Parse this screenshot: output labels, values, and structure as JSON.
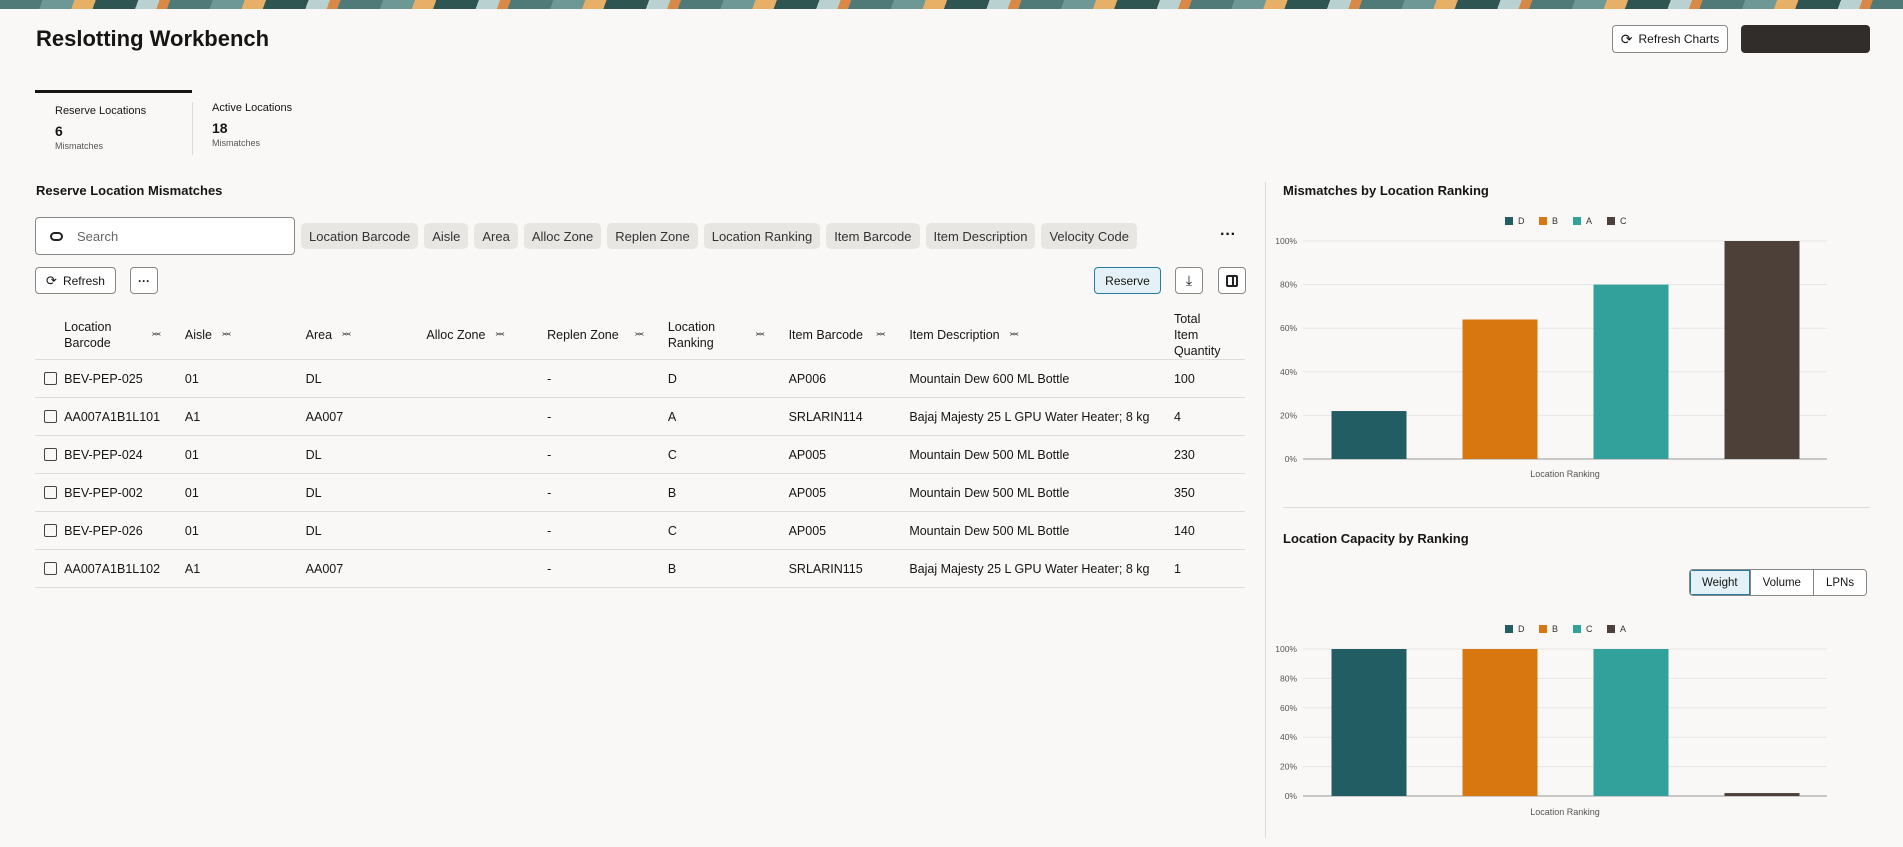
{
  "header": {
    "title": "Reslotting Workbench",
    "refresh_charts": "Refresh Charts"
  },
  "tabs": [
    {
      "label": "Reserve Locations",
      "count": "6",
      "sub": "Mismatches"
    },
    {
      "label": "Active Locations",
      "count": "18",
      "sub": "Mismatches"
    }
  ],
  "section_title": "Reserve Location Mismatches",
  "search": {
    "placeholder": "Search"
  },
  "filter_chips": [
    "Location Barcode",
    "Aisle",
    "Area",
    "Alloc Zone",
    "Replen Zone",
    "Location Ranking",
    "Item Barcode",
    "Item Description",
    "Velocity Code"
  ],
  "toolbar": {
    "refresh": "Refresh",
    "reserve": "Reserve"
  },
  "table": {
    "columns": [
      "Location Barcode",
      "Aisle",
      "Area",
      "Alloc Zone",
      "Replen Zone",
      "Location Ranking",
      "Item Barcode",
      "Item Description",
      "Total Item Quantity"
    ],
    "rows": [
      [
        "BEV-PEP-025",
        "01",
        "DL",
        "",
        "-",
        "D",
        "AP006",
        "Mountain Dew 600 ML Bottle",
        "100"
      ],
      [
        "AA007A1B1L101",
        "A1",
        "AA007",
        "",
        "-",
        "A",
        "SRLARIN114",
        "Bajaj Majesty 25 L GPU Water Heater; 8 kg",
        "4"
      ],
      [
        "BEV-PEP-024",
        "01",
        "DL",
        "",
        "-",
        "C",
        "AP005",
        "Mountain Dew 500 ML Bottle",
        "230"
      ],
      [
        "BEV-PEP-002",
        "01",
        "DL",
        "",
        "-",
        "B",
        "AP005",
        "Mountain Dew 500 ML Bottle",
        "350"
      ],
      [
        "BEV-PEP-026",
        "01",
        "DL",
        "",
        "-",
        "C",
        "AP005",
        "Mountain Dew 500 ML Bottle",
        "140"
      ],
      [
        "AA007A1B1L102",
        "A1",
        "AA007",
        "",
        "-",
        "B",
        "SRLARIN115",
        "Bajaj Majesty 25 L GPU Water Heater; 8 kg",
        "1"
      ]
    ]
  },
  "capacity_toggle": [
    "Weight",
    "Volume",
    "LPNs"
  ],
  "chart_data": [
    {
      "type": "bar",
      "title": "Mismatches by Location Ranking",
      "xlabel": "Location Ranking",
      "ylabel": "",
      "ylim": [
        0,
        100
      ],
      "yticks": [
        "0%",
        "20%",
        "40%",
        "60%",
        "80%",
        "100%"
      ],
      "categories": [
        "D",
        "B",
        "A",
        "C"
      ],
      "values": [
        22,
        64,
        80,
        100
      ],
      "colors": [
        "#225d64",
        "#d8770f",
        "#32a09b",
        "#4d4038"
      ],
      "legend": "top-center"
    },
    {
      "type": "bar",
      "title": "Location Capacity by Ranking",
      "xlabel": "Location Ranking",
      "ylabel": "",
      "ylim": [
        0,
        100
      ],
      "yticks": [
        "0%",
        "20%",
        "40%",
        "60%",
        "80%",
        "100%"
      ],
      "categories": [
        "D",
        "B",
        "C",
        "A"
      ],
      "values": [
        100,
        100,
        100,
        2
      ],
      "colors": [
        "#225d64",
        "#d8770f",
        "#32a09b",
        "#4d4038"
      ],
      "legend": "top-center"
    }
  ]
}
